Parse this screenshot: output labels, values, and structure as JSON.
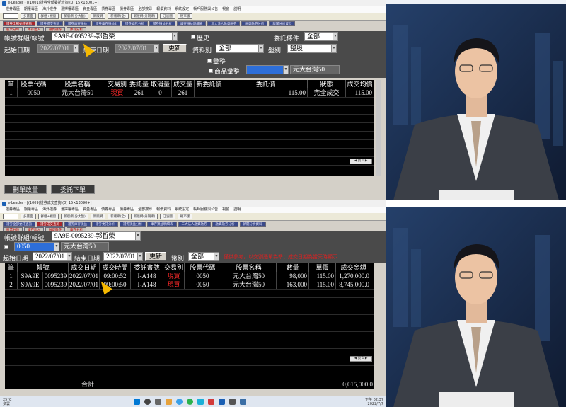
{
  "window1": {
    "title": "e-Leader - [(1001)證券全部委託查詢 (0) 15×13001+]",
    "menu": [
      "證券專區",
      "期權專區",
      "海外證券",
      "選擇權專區",
      "資金專區",
      "債券專區",
      "債券專區",
      "全部搜尋",
      "報價資料",
      "系統設定",
      "帳戶服務與公告",
      "視窗",
      "說明"
    ],
    "toolbar": [
      "多畫面",
      "群組+視窗",
      "新版網(分大盤)",
      "新版網",
      "新版網(全)",
      "新版網(分期網)",
      "江波圖",
      "輕市版"
    ],
    "tabs": [
      "證券全部委託查詢",
      "證券成交查詢",
      "證券庫存損益",
      "證券庫存損益2",
      "證券委託分析",
      "證券損益分析",
      "庫存損益明細表",
      "三大法人融資融券",
      "融資融券分析",
      "新聞分析資料"
    ],
    "tabs2": [
      "股票分時",
      "庫存出入",
      "融資融券",
      "庫存分析"
    ],
    "account_label": "帳號群組/帳號",
    "account_value": "9A9E-0095239-郭哲榮",
    "history_label": "歷史",
    "condition_label": "委託條件",
    "condition_value": "全部",
    "start_date_label": "起始日期",
    "start_date": "2022/07/01",
    "end_date_label": "結束日期",
    "end_date": "2022/07/01",
    "refresh_label": "更新",
    "data_type_label": "資料別",
    "data_type_value": "全部",
    "market_label": "盤別",
    "market_value": "整股",
    "group_label": "彙整",
    "product_label": "商品彙整",
    "product_value": "元大台灣50",
    "columns": [
      "筆",
      "股票代碼",
      "股票名稱",
      "交易別",
      "委託量",
      "取消量",
      "成交量",
      "新委託價",
      "委託價",
      "狀態",
      "成交均價"
    ],
    "rows": [
      [
        "1",
        "0050",
        "元大台灣50",
        "現買",
        "261",
        "0",
        "261",
        "",
        "115.00",
        "完全成交",
        "115.00"
      ]
    ],
    "pager": "◀ 頁 1 ▶",
    "modify_button": "刪單改量",
    "order_button": "委託下單"
  },
  "window2": {
    "title": "e-Leader - [(1009)證券成交查詢 (0) 15×13090+]",
    "menu": [
      "證券專區",
      "期權專區",
      "海外證券",
      "選擇權專區",
      "資金專區",
      "債券專區",
      "債券專區",
      "全部搜尋",
      "報價資料",
      "系統設定",
      "帳戶服務與公告",
      "視窗",
      "說明"
    ],
    "toolbar": [
      "多畫面",
      "群組+視窗",
      "新版網(分大盤)",
      "新版網",
      "新版網(全)",
      "新版網(分期網)",
      "江波圖",
      "輕市版"
    ],
    "tabs": [
      "證券全部委託查詢",
      "證券成交查詢",
      "證券庫存損益",
      "證券委託分析",
      "證券損益分析",
      "庫存損益明細表",
      "三大法人融資融券",
      "融資融券分析",
      "新聞分析資料"
    ],
    "tabs2": [
      "股票分時",
      "庫存出入",
      "融資融券",
      "庫存分析"
    ],
    "account_label": "帳號群組/帳號",
    "account_value": "9A9E-0095239-郭哲榮",
    "stock_code": "0050",
    "stock_name": "元大台灣50",
    "start_date_label": "起始日期",
    "start_date": "2022/07/01",
    "end_date_label": "結束日期",
    "end_date": "2022/07/01",
    "refresh_label": "更新",
    "currency_label": "幣別",
    "currency_value": "全部",
    "notice": "僅供參考，以交割憑單為準；成交日期為當天時顯示",
    "columns": [
      "筆",
      "帳號",
      "成交日期",
      "成交時間",
      "委託書號",
      "交易別",
      "股票代碼",
      "股票名稱",
      "數量",
      "單價",
      "成交金額"
    ],
    "rows": [
      [
        "1",
        "S9A9E",
        "0095239",
        "2022/07/01",
        "09:00:52",
        "I-A148",
        "現買",
        "0050",
        "元大台灣50",
        "98,000",
        "115.00",
        "1,270,000.0"
      ],
      [
        "2",
        "S9A9E",
        "0095239",
        "2022/07/01",
        "09:00:50",
        "I-A148",
        "現買",
        "0050",
        "元大台灣50",
        "163,000",
        "115.00",
        "8,745,000.0"
      ]
    ],
    "pager": "◀ 頁 1 ▶",
    "total_label": "合計",
    "total_value": "0,015,000.0"
  },
  "taskbar": {
    "weather": "25°C",
    "weather_sub": "多雲",
    "time": "下午 02:37",
    "date": "2022/7/7"
  },
  "colors": {
    "panel_bg": "#4a4a4a",
    "grid_bg": "#000000",
    "buy_red": "#ff2a2a",
    "accent_blue": "#2d6ed8",
    "cursor_yellow": "#f5b800"
  }
}
